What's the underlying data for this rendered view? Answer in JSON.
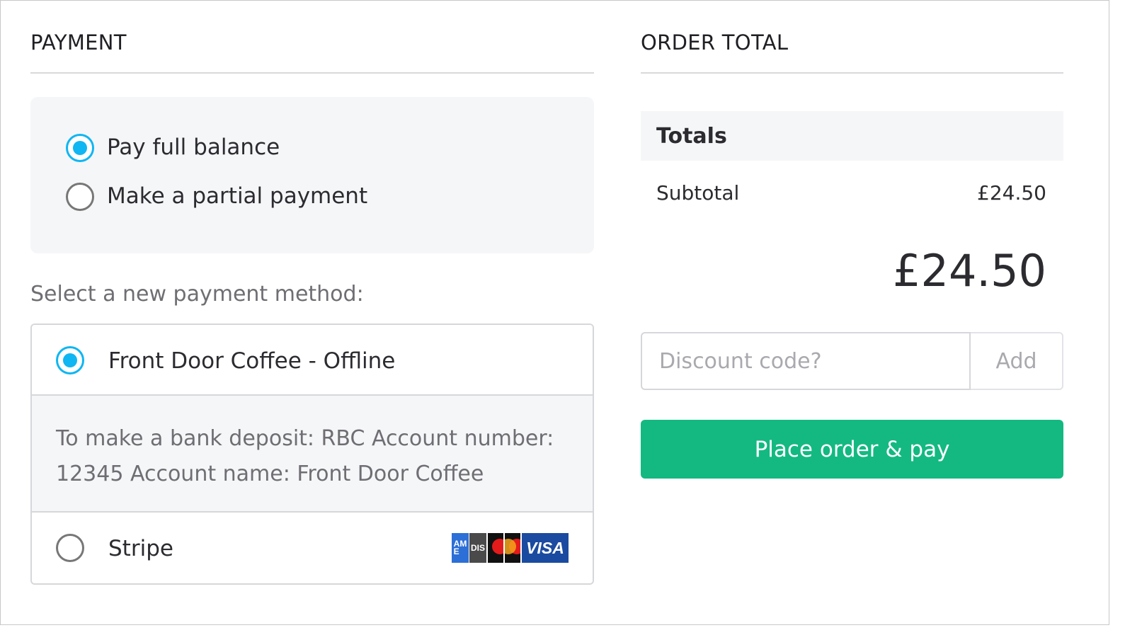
{
  "payment": {
    "heading": "PAYMENT",
    "balance_options": [
      {
        "label": "Pay full balance",
        "checked": true
      },
      {
        "label": "Make a partial payment",
        "checked": false
      }
    ],
    "select_prompt": "Select a new payment method:",
    "methods": [
      {
        "label": "Front Door Coffee - Offline",
        "checked": true,
        "details": "To make a bank deposit: RBC Account number: 12345 Account name: Front Door Coffee"
      },
      {
        "label": "Stripe",
        "checked": false
      }
    ],
    "card_logos": {
      "amex": "AMERICAN EXPRESS",
      "discover": "DISCOVER",
      "visa": "VISA"
    }
  },
  "order": {
    "heading": "ORDER TOTAL",
    "totals_label": "Totals",
    "subtotal_label": "Subtotal",
    "subtotal_value": "£24.50",
    "grand_total": "£24.50",
    "discount_placeholder": "Discount code?",
    "discount_add_label": "Add",
    "place_order_label": "Place order & pay"
  },
  "colors": {
    "accent_radio": "#0fb6f2",
    "primary_button": "#13b981"
  }
}
